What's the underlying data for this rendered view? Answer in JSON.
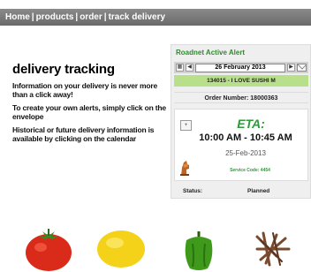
{
  "nav": {
    "items": [
      {
        "label": "Home"
      },
      {
        "label": "products"
      },
      {
        "label": "order"
      },
      {
        "label": "track delivery"
      }
    ],
    "separator": "|"
  },
  "intro": {
    "heading": "delivery tracking",
    "paragraphs": [
      "Information on your delivery is never more than a click away!",
      "To create your own alerts, simply click on the envelope",
      "Historical or future delivery information is available by clicking on the calendar"
    ]
  },
  "alert": {
    "title": "Roadnet Active Alert",
    "prev_label": "◀",
    "next_label": "▶",
    "date": "26 February 2013",
    "customer": "134015 - I LOVE SUSHI M",
    "order_number": "Order Number: 18000363",
    "expand_label": "+",
    "eta_label": "ETA:",
    "eta_range": "10:00 AM - 10:45 AM",
    "eta_date": "25-Feb-2013",
    "service_code": "Service Code: 4454",
    "status_label": "Status:",
    "status_value": "Planned"
  },
  "colors": {
    "nav_bg": "#7a7a7a",
    "alert_title": "#2f8a2f",
    "customer_bar": "#b8df8a",
    "eta": "#2e9a3a"
  },
  "icons": [
    "truck-icon",
    "calendar-icon",
    "envelope-icon",
    "expand-icon"
  ],
  "produce": [
    "tomato",
    "lemon",
    "green-pepper",
    "dried-spice"
  ]
}
